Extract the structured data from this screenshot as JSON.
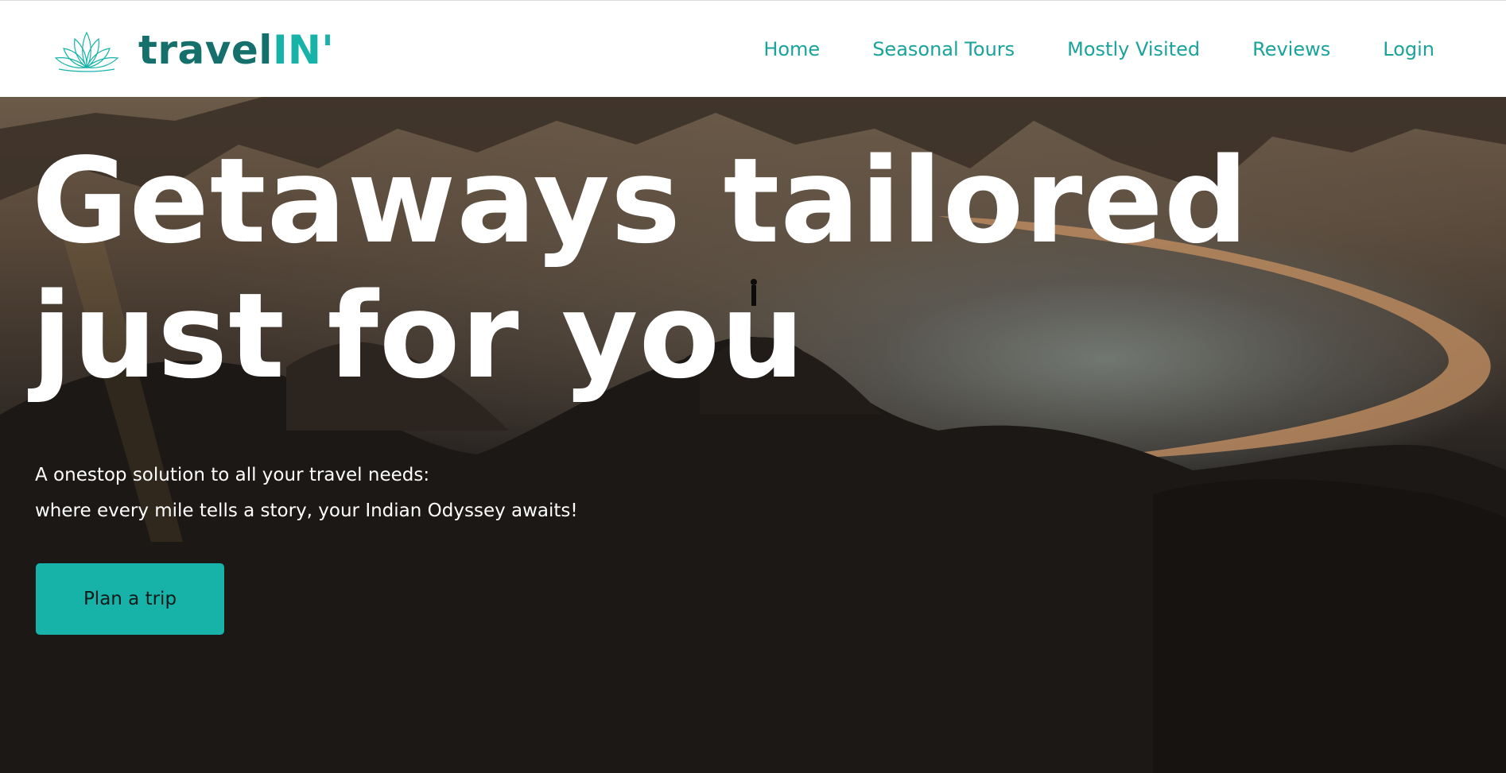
{
  "brand": {
    "name_part1": "travel",
    "name_part2": "IN'",
    "logo_icon": "lotus-icon",
    "color_dark": "#156f6b",
    "color_accent": "#17b3a9"
  },
  "nav": {
    "items": [
      {
        "label": "Home"
      },
      {
        "label": "Seasonal Tours"
      },
      {
        "label": "Mostly Visited"
      },
      {
        "label": "Reviews"
      },
      {
        "label": "Login"
      }
    ],
    "color": "#1aa39b"
  },
  "hero": {
    "headline_line1": "Getaways tailored",
    "headline_line2": "just for you",
    "subtitle_line1": "A onestop solution to all your travel needs:",
    "subtitle_line2": "where every mile tells a story, your Indian Odyssey awaits!",
    "cta_label": "Plan a trip",
    "cta_color": "#17b3a9"
  }
}
